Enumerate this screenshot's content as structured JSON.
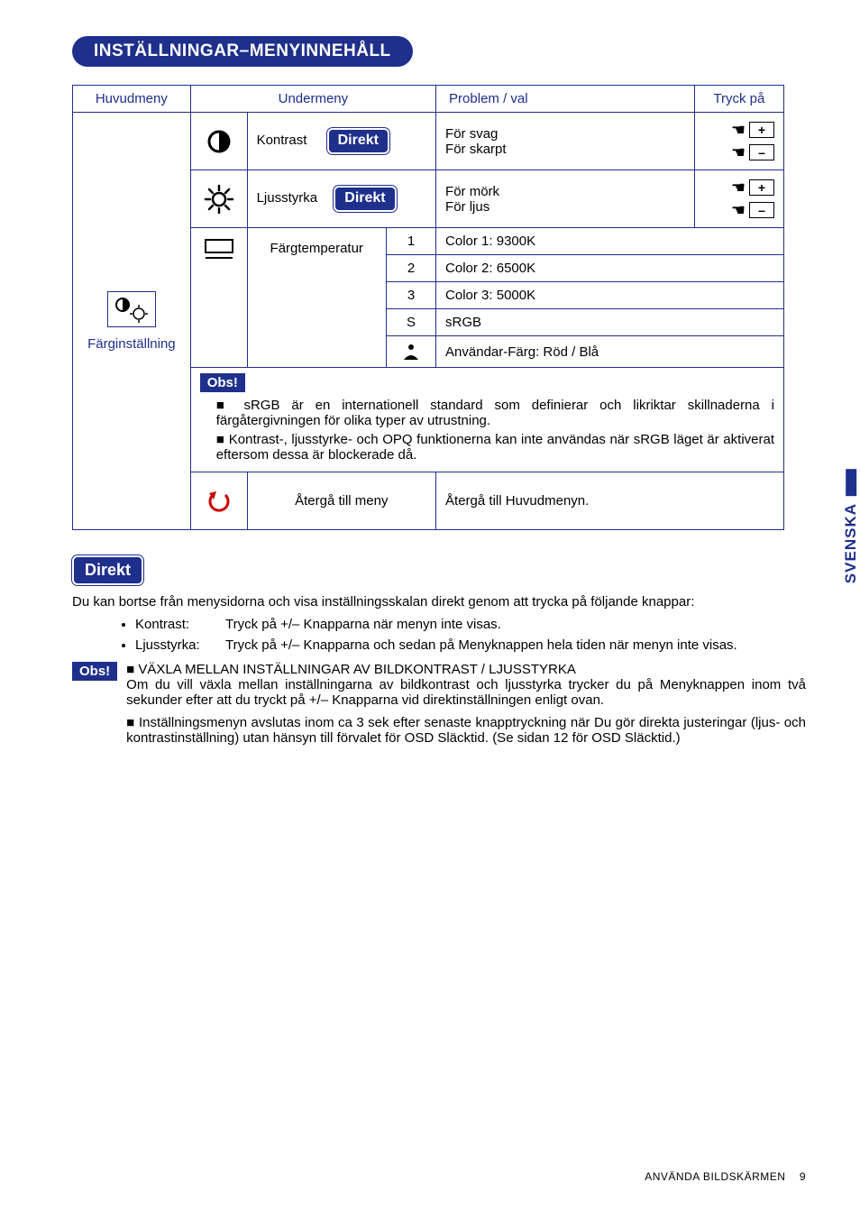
{
  "section_title": "INSTÄLLNINGAR–MENYINNEHÅLL",
  "headers": {
    "main": "Huvudmeny",
    "sub": "Undermeny",
    "problem": "Problem / val",
    "press": "Tryck på"
  },
  "main_category": "Färginställning",
  "submenus": {
    "contrast": {
      "label": "Kontrast",
      "badge": "Direkt"
    },
    "brightness": {
      "label": "Ljusstyrka",
      "badge": "Direkt"
    },
    "colortemp": {
      "label": "Färgtemperatur"
    },
    "return": {
      "label": "Återgå till meny"
    }
  },
  "problems": {
    "contrast": {
      "a": "För svag",
      "b": "För skarpt"
    },
    "brightness": {
      "a": "För mörk",
      "b": "För ljus"
    },
    "return": "Återgå till Huvudmenyn."
  },
  "color_options": {
    "o1": {
      "opt": "1",
      "desc": "Color 1: 9300K"
    },
    "o2": {
      "opt": "2",
      "desc": "Color 2: 6500K"
    },
    "o3": {
      "opt": "3",
      "desc": "Color 3: 5000K"
    },
    "o4": {
      "opt": "S",
      "desc": "sRGB"
    },
    "o5": {
      "desc": "Användar-Färg: Röd / Blå"
    }
  },
  "keys": {
    "plus": "+",
    "minus": "–"
  },
  "note_box": {
    "title": "Obs!",
    "items": [
      "sRGB är en internationell standard som definierar och likriktar skillnaderna i färgåtergivningen för olika typer av utrustning.",
      "Kontrast-, ljusstyrke- och OPQ funktionerna kan inte användas när sRGB läget är aktiverat eftersom dessa är blockerade då."
    ]
  },
  "direkt_section": {
    "title": "Direkt",
    "intro": "Du kan bortse från menysidorna och visa inställningsskalan direkt genom att trycka på följande knappar:",
    "bullets": [
      {
        "term": "Kontrast:",
        "body": "Tryck på +/– Knapparna när menyn inte visas."
      },
      {
        "term": "Ljusstyrka:",
        "body": "Tryck på +/– Knapparna och sedan på Menyknappen hela tiden när menyn inte visas."
      }
    ]
  },
  "lower_note": {
    "title": "Obs!",
    "items": [
      "VÄXLA MELLAN INSTÄLLNINGAR AV BILDKONTRAST / LJUSSTYRKA\nOm du vill växla mellan inställningarna av bildkontrast och ljusstyrka trycker du på Menyknappen inom två sekunder efter att du tryckt på +/– Knapparna vid direktinställningen enligt ovan.",
      "Inställningsmenyn avslutas inom ca 3 sek efter senaste knapptryckning när Du gör direkta justeringar (ljus- och kontrastinställning) utan hänsyn till förvalet för OSD Släcktid. (Se sidan 12 för OSD Släcktid.)"
    ]
  },
  "side_tab": "SVENSKA",
  "footer": {
    "text": "ANVÄNDA BILDSKÄRMEN",
    "page": "9"
  }
}
